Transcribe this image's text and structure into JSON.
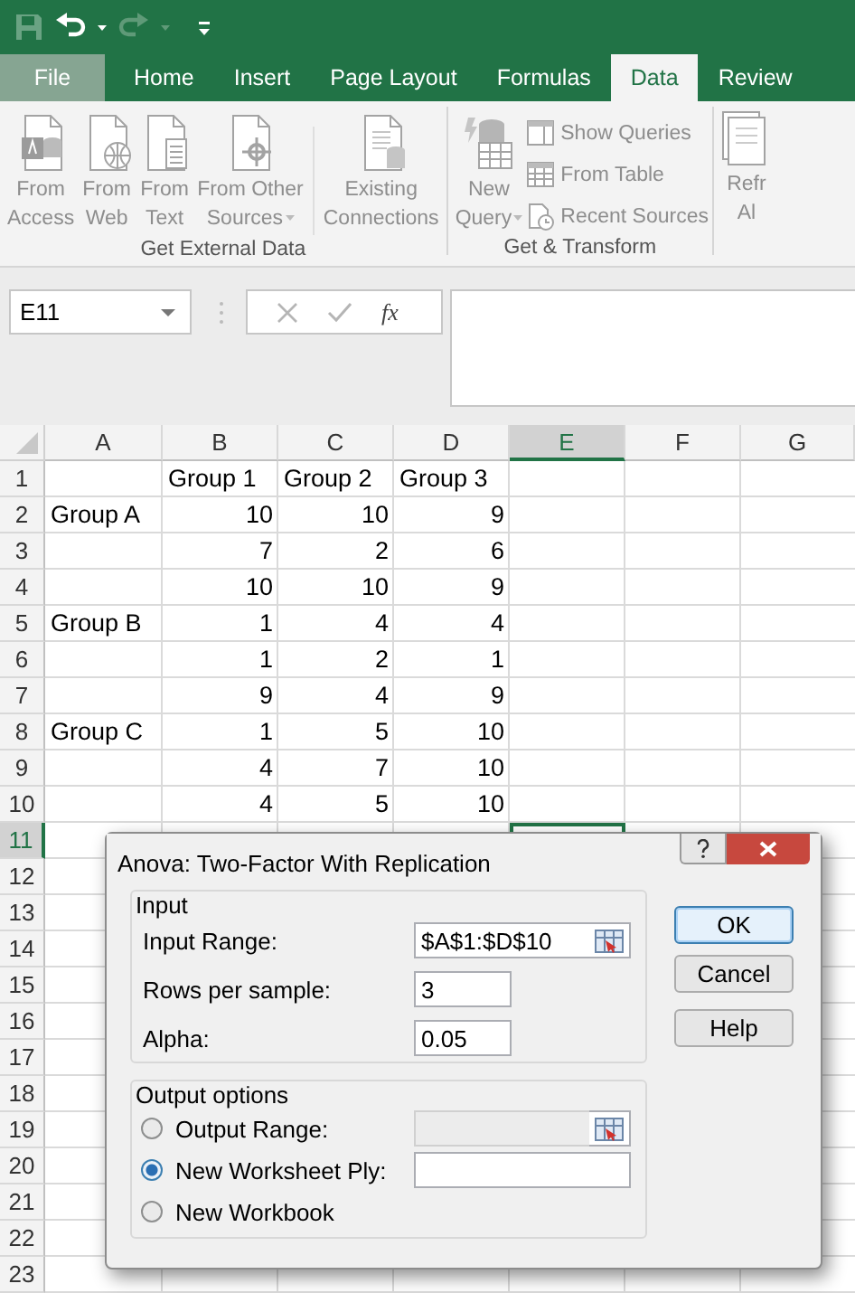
{
  "tabs": [
    {
      "label": "File",
      "kind": "file",
      "selected": false
    },
    {
      "label": "Home",
      "kind": "tab",
      "selected": false
    },
    {
      "label": "Insert",
      "kind": "tab",
      "selected": false
    },
    {
      "label": "Page Layout",
      "kind": "tab",
      "selected": false
    },
    {
      "label": "Formulas",
      "kind": "tab",
      "selected": false
    },
    {
      "label": "Data",
      "kind": "tab",
      "selected": true
    },
    {
      "label": "Review",
      "kind": "tab",
      "selected": false
    }
  ],
  "ribbon": {
    "groups": [
      {
        "label": "Get External Data",
        "items": [
          {
            "kind": "large",
            "lines": [
              "From",
              "Access"
            ],
            "disabled": true
          },
          {
            "kind": "large",
            "lines": [
              "From",
              "Web"
            ],
            "disabled": true
          },
          {
            "kind": "large",
            "lines": [
              "From",
              "Text"
            ],
            "disabled": true
          },
          {
            "kind": "large",
            "lines": [
              "From Other",
              "Sources"
            ],
            "dropdown": true,
            "disabled": true
          },
          {
            "kind": "separator"
          },
          {
            "kind": "large",
            "lines": [
              "Existing",
              "Connections"
            ],
            "disabled": true
          }
        ]
      },
      {
        "label": "Get & Transform",
        "items": [
          {
            "kind": "large",
            "lines": [
              "New",
              "Query"
            ],
            "dropdown": true,
            "disabled": true
          },
          {
            "kind": "small",
            "label": "Show Queries",
            "disabled": true
          },
          {
            "kind": "small",
            "label": "From Table",
            "disabled": true
          },
          {
            "kind": "small",
            "label": "Recent Sources",
            "disabled": true
          }
        ]
      },
      {
        "items": [
          {
            "kind": "large",
            "lines": [
              "Refr",
              "Al"
            ],
            "disabled": true
          }
        ]
      }
    ]
  },
  "formula_bar": {
    "name_box": "E11",
    "function_label": "fx"
  },
  "sheet": {
    "columns": [
      {
        "label": "A",
        "selected": false
      },
      {
        "label": "B",
        "selected": false
      },
      {
        "label": "C",
        "selected": false
      },
      {
        "label": "D",
        "selected": false
      },
      {
        "label": "E",
        "selected": true
      },
      {
        "label": "F",
        "selected": false
      },
      {
        "label": "G",
        "selected": false
      }
    ],
    "rows": [
      {
        "label": "1",
        "selected": false,
        "cells": [
          null,
          {
            "value": "Group 1",
            "kind": "text"
          },
          {
            "value": "Group 2",
            "kind": "text"
          },
          {
            "value": "Group 3",
            "kind": "text"
          }
        ]
      },
      {
        "label": "2",
        "selected": false,
        "cells": [
          {
            "value": "Group A",
            "kind": "text"
          },
          {
            "value": "10",
            "kind": "number"
          },
          {
            "value": "10",
            "kind": "number"
          },
          {
            "value": "9",
            "kind": "number"
          }
        ]
      },
      {
        "label": "3",
        "selected": false,
        "cells": [
          null,
          {
            "value": "7",
            "kind": "number"
          },
          {
            "value": "2",
            "kind": "number"
          },
          {
            "value": "6",
            "kind": "number"
          }
        ]
      },
      {
        "label": "4",
        "selected": false,
        "cells": [
          null,
          {
            "value": "10",
            "kind": "number"
          },
          {
            "value": "10",
            "kind": "number"
          },
          {
            "value": "9",
            "kind": "number"
          }
        ]
      },
      {
        "label": "5",
        "selected": false,
        "cells": [
          {
            "value": "Group B",
            "kind": "text"
          },
          {
            "value": "1",
            "kind": "number"
          },
          {
            "value": "4",
            "kind": "number"
          },
          {
            "value": "4",
            "kind": "number"
          }
        ]
      },
      {
        "label": "6",
        "selected": false,
        "cells": [
          null,
          {
            "value": "1",
            "kind": "number"
          },
          {
            "value": "2",
            "kind": "number"
          },
          {
            "value": "1",
            "kind": "number"
          }
        ]
      },
      {
        "label": "7",
        "selected": false,
        "cells": [
          null,
          {
            "value": "9",
            "kind": "number"
          },
          {
            "value": "4",
            "kind": "number"
          },
          {
            "value": "9",
            "kind": "number"
          }
        ]
      },
      {
        "label": "8",
        "selected": false,
        "cells": [
          {
            "value": "Group C",
            "kind": "text"
          },
          {
            "value": "1",
            "kind": "number"
          },
          {
            "value": "5",
            "kind": "number"
          },
          {
            "value": "10",
            "kind": "number"
          }
        ]
      },
      {
        "label": "9",
        "selected": false,
        "cells": [
          null,
          {
            "value": "4",
            "kind": "number"
          },
          {
            "value": "7",
            "kind": "number"
          },
          {
            "value": "10",
            "kind": "number"
          }
        ]
      },
      {
        "label": "10",
        "selected": false,
        "cells": [
          null,
          {
            "value": "4",
            "kind": "number"
          },
          {
            "value": "5",
            "kind": "number"
          },
          {
            "value": "10",
            "kind": "number"
          }
        ]
      },
      {
        "label": "11",
        "selected": true
      },
      {
        "label": "12",
        "selected": false
      },
      {
        "label": "13",
        "selected": false
      },
      {
        "label": "14",
        "selected": false
      },
      {
        "label": "15",
        "selected": false
      },
      {
        "label": "16",
        "selected": false
      },
      {
        "label": "17",
        "selected": false
      },
      {
        "label": "18",
        "selected": false
      },
      {
        "label": "19",
        "selected": false
      },
      {
        "label": "20",
        "selected": false
      },
      {
        "label": "21",
        "selected": false
      },
      {
        "label": "22",
        "selected": false
      },
      {
        "label": "23",
        "selected": false
      }
    ]
  },
  "dialog": {
    "title": "Anova: Two-Factor With Replication",
    "input": {
      "legend": "Input",
      "fields": [
        {
          "label": "Input Range:",
          "value": "$A$1:$D$10",
          "kind": "range"
        },
        {
          "label": "Rows per sample:",
          "value": "3",
          "kind": "text"
        },
        {
          "label": "Alpha:",
          "value": "0.05",
          "kind": "text"
        }
      ]
    },
    "output": {
      "legend": "Output options",
      "options": [
        {
          "label": "Output Range:",
          "selected": false,
          "kind": "range",
          "disabled": true
        },
        {
          "label": "New Worksheet Ply:",
          "selected": true,
          "kind": "text",
          "disabled": false
        },
        {
          "label": "New Workbook",
          "selected": false,
          "kind": "plain"
        }
      ]
    },
    "buttons": [
      {
        "label": "OK",
        "default": true
      },
      {
        "label": "Cancel",
        "default": false
      },
      {
        "label": "Help",
        "default": false
      }
    ]
  }
}
